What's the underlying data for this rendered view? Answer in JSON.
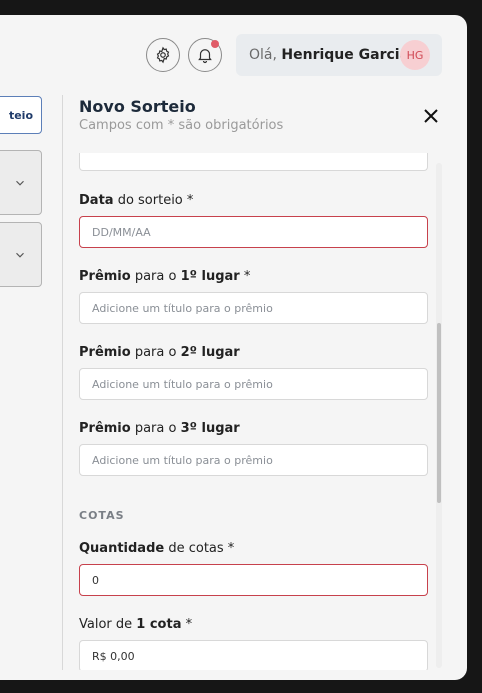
{
  "header": {
    "settings_icon": "gear-icon",
    "notification_icon": "bell-icon",
    "greeting_prefix": "Olá,",
    "user_name": "Henrique Garcia",
    "avatar_initials": "HG"
  },
  "left_panel": {
    "tab_label": "teio"
  },
  "drawer": {
    "title": "Novo Sorteio",
    "subtitle": "Campos com * são obrigatórios",
    "fields": {
      "date": {
        "label_bold": "Data",
        "label_rest": " do sorteio *",
        "placeholder": "DD/MM/AA"
      },
      "prize1": {
        "label_bold": "Prêmio",
        "label_mid": " para o ",
        "label_bold2": "1º lugar",
        "label_rest": " *",
        "placeholder": "Adicione um título para o prêmio"
      },
      "prize2": {
        "label_bold": "Prêmio",
        "label_mid": " para o ",
        "label_bold2": "2º lugar",
        "placeholder": "Adicione um título para o prêmio"
      },
      "prize3": {
        "label_bold": "Prêmio",
        "label_mid": " para o ",
        "label_bold2": "3º lugar",
        "placeholder": "Adicione um título para o prêmio"
      },
      "section_cotas": "COTAS",
      "quantity": {
        "label_bold": "Quantidade",
        "label_rest": " de cotas *",
        "value": "0"
      },
      "price": {
        "label_pre": "Valor de ",
        "label_bold": "1 cota",
        "label_rest": " *",
        "value": "R$ 0,00"
      }
    }
  },
  "colors": {
    "error_border": "#c7414c",
    "notification_dot": "#e05b67",
    "avatar_bg": "#f7cfd2",
    "accent_blue": "#5c7fb8"
  }
}
